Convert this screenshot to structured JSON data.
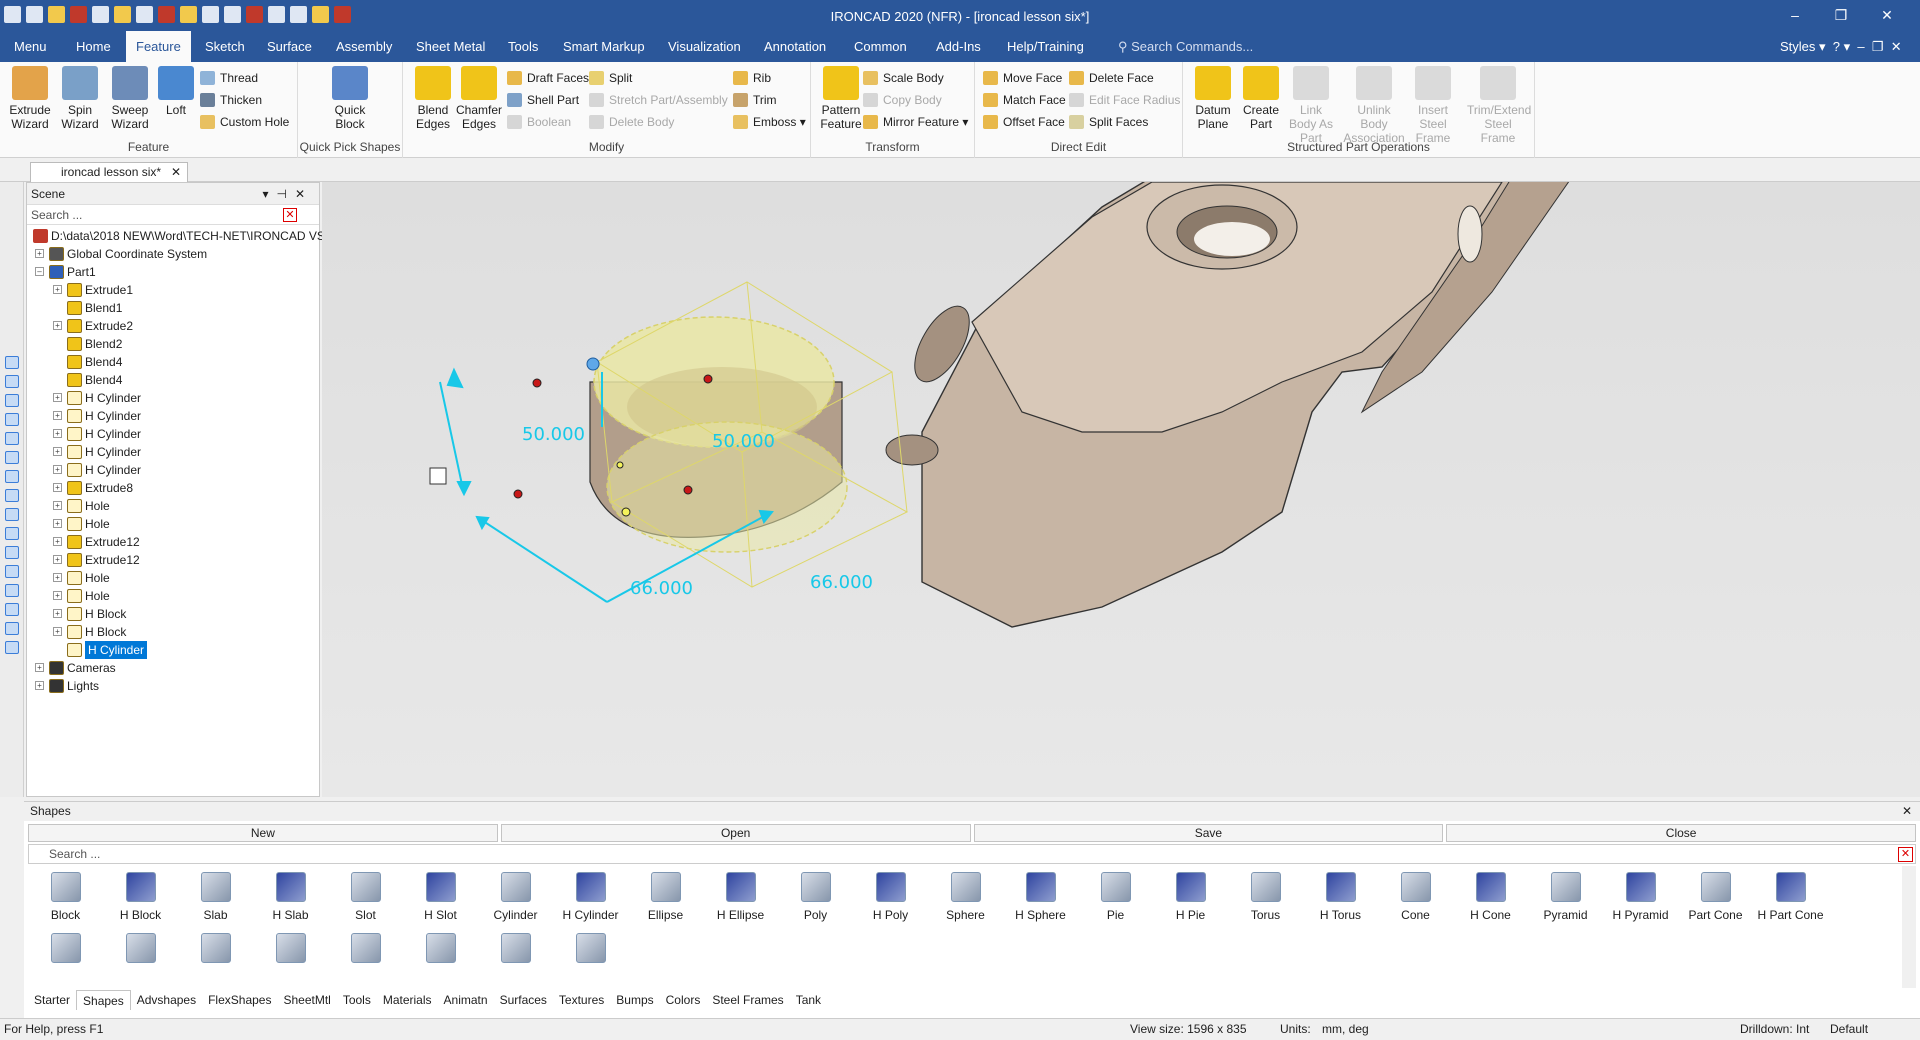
{
  "app": {
    "title": "IRONCAD 2020 (NFR) - [ironcad lesson six*]",
    "window_controls": [
      "–",
      "❐",
      "✕"
    ]
  },
  "menubar": {
    "tabs": [
      "Menu",
      "Home",
      "Feature",
      "Sketch",
      "Surface",
      "Assembly",
      "Sheet Metal",
      "Tools",
      "Smart Markup",
      "Visualization",
      "Annotation",
      "Common",
      "Add-Ins",
      "Help/Training"
    ],
    "active": "Feature",
    "search_placeholder": "Search Commands...",
    "styles_label": "Styles"
  },
  "ribbon": {
    "feature_group": {
      "label": "Feature",
      "extrude": "Extrude Wizard",
      "spin": "Spin Wizard",
      "sweep": "Sweep Wizard",
      "loft": "Loft",
      "thread": "Thread",
      "thicken": "Thicken",
      "custom_hole": "Custom Hole"
    },
    "quickpick_group": {
      "label": "Quick Pick Shapes",
      "quick_block": "Quick Block"
    },
    "modify_group": {
      "label": "Modify",
      "blend": "Blend Edges",
      "chamfer": "Chamfer Edges",
      "draft": "Draft Faces",
      "shell": "Shell Part",
      "boolean": "Boolean",
      "split": "Split",
      "stretch": "Stretch Part/Assembly",
      "delete_body": "Delete Body",
      "rib": "Rib",
      "trim": "Trim",
      "emboss": "Emboss"
    },
    "transform_group": {
      "label": "Transform",
      "pattern": "Pattern Feature",
      "scale_body": "Scale Body",
      "copy_body": "Copy Body",
      "mirror": "Mirror Feature"
    },
    "direct_edit_group": {
      "label": "Direct Edit",
      "move_face": "Move Face",
      "match_face": "Match Face",
      "offset_face": "Offset Face",
      "delete_face": "Delete Face",
      "edit_face_radius": "Edit Face Radius",
      "split_faces": "Split Faces"
    },
    "structured_group": {
      "label": "Structured Part Operations",
      "datum": "Datum Plane",
      "create_part": "Create Part",
      "link_body": "Link Body As Part",
      "unlink_body": "Unlink Body Association",
      "insert_steel": "Insert Steel Frame",
      "trim_steel": "Trim/Extend Steel Frame"
    }
  },
  "doc_tab": {
    "label": "ironcad lesson six*",
    "close": "✕"
  },
  "scene": {
    "title": "Scene",
    "search_placeholder": "Search ...",
    "root": "D:\\data\\2018 NEW\\Word\\TECH-NET\\IRONCAD VS",
    "items": [
      "Global Coordinate System",
      "Part1",
      "Extrude1",
      "Blend1",
      "Extrude2",
      "Blend2",
      "Blend4",
      "Blend4",
      "H Cylinder",
      "H Cylinder",
      "H Cylinder",
      "H Cylinder",
      "H Cylinder",
      "Extrude8",
      "Hole",
      "Hole",
      "Extrude12",
      "Extrude12",
      "Hole",
      "Hole",
      "H Block",
      "H Block",
      "H Cylinder",
      "Cameras",
      "Lights"
    ],
    "selected_index": 22
  },
  "viewport": {
    "dimensions": [
      "50.000",
      "50.000",
      "66.000",
      "66.000"
    ],
    "accent_color": "#18c8e8",
    "part_color": "#c5b3a2"
  },
  "shapes_panel": {
    "title": "Shapes",
    "buttons": [
      "New",
      "Open",
      "Save",
      "Close"
    ],
    "search_placeholder": "Search ...",
    "items": [
      "Block",
      "H Block",
      "Slab",
      "H Slab",
      "Slot",
      "H Slot",
      "Cylinder",
      "H Cylinder",
      "Ellipse",
      "H Ellipse",
      "Poly",
      "H Poly",
      "Sphere",
      "H Sphere",
      "Pie",
      "H Pie",
      "Torus",
      "H Torus",
      "Cone",
      "H Cone",
      "Pyramid",
      "H Pyramid",
      "Part Cone",
      "H Part Cone"
    ],
    "catalog_tabs": [
      "Starter",
      "Shapes",
      "Advshapes",
      "FlexShapes",
      "SheetMtl",
      "Tools",
      "Materials",
      "Animatn",
      "Surfaces",
      "Textures",
      "Bumps",
      "Colors",
      "Steel Frames",
      "Tank"
    ],
    "active_tab": "Shapes"
  },
  "status": {
    "help": "For Help, press F1",
    "view_size": "View size: 1596 x  835",
    "units_label": "Units:",
    "units_value": "mm, deg",
    "drilldown": "Drilldown: Int",
    "default": "Default"
  }
}
